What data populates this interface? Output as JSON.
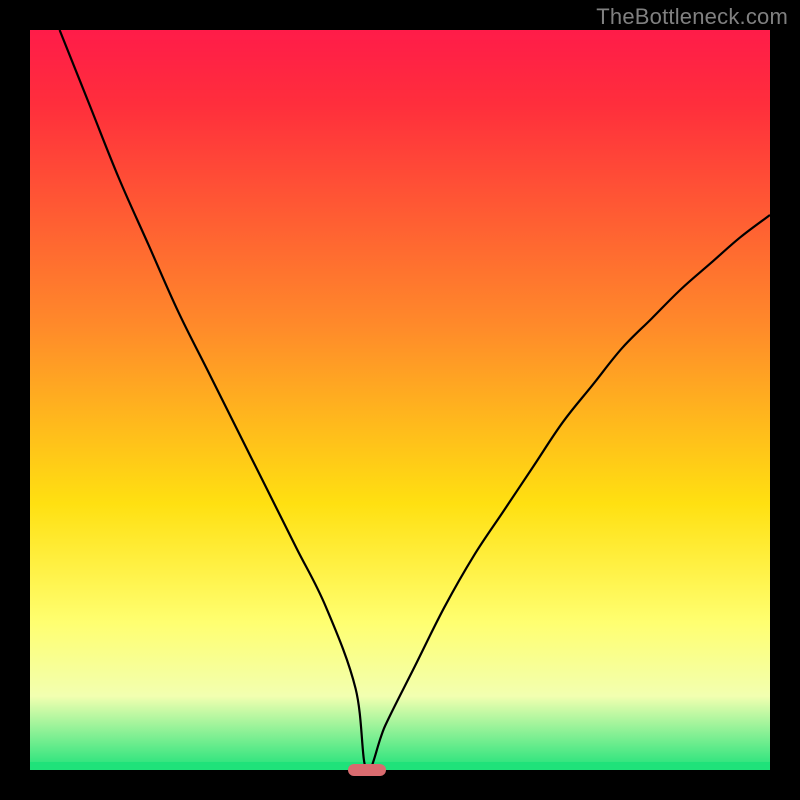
{
  "attribution": "TheBottleneck.com",
  "colors": {
    "top": "#ff1c49",
    "red": "#ff2e3c",
    "orange": "#ff8a2a",
    "yellow": "#ffe011",
    "lightyellow": "#ffff70",
    "paleyellow": "#f2ffb0",
    "green": "#1fe27a",
    "marker": "#d96b6f"
  },
  "plot": {
    "inner_left": 30,
    "inner_top": 30,
    "inner_width": 740,
    "inner_height": 740
  },
  "chart_data": {
    "type": "line",
    "title": "",
    "xlabel": "",
    "ylabel": "",
    "xlim": [
      0,
      100
    ],
    "ylim": [
      0,
      100
    ],
    "grid": false,
    "legend": false,
    "marker": {
      "x": 45.5,
      "y": 0,
      "color": "#d96b6f"
    },
    "series": [
      {
        "name": "curve",
        "x": [
          4,
          8,
          12,
          16,
          20,
          24,
          28,
          32,
          36,
          40,
          44,
          45.5,
          48,
          52,
          56,
          60,
          64,
          68,
          72,
          76,
          80,
          84,
          88,
          92,
          96,
          100
        ],
        "y": [
          100,
          90,
          80,
          71,
          62,
          54,
          46,
          38,
          30,
          22,
          11,
          0,
          6,
          14,
          22,
          29,
          35,
          41,
          47,
          52,
          57,
          61,
          65,
          68.5,
          72,
          75
        ]
      }
    ]
  }
}
